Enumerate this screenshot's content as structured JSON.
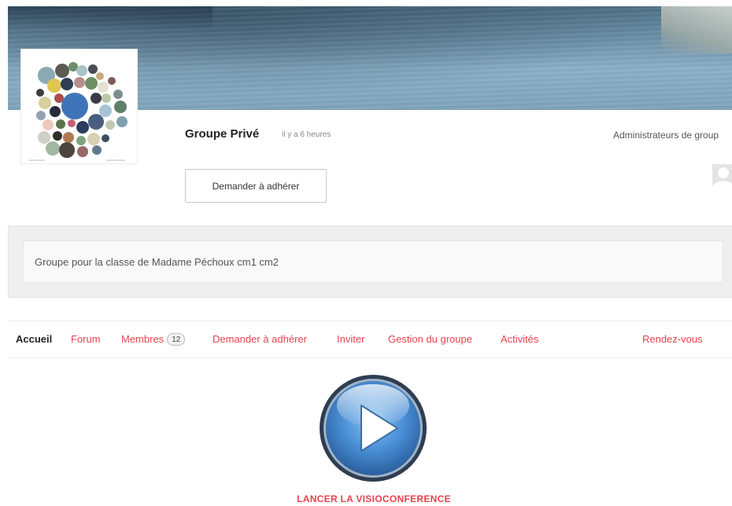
{
  "group": {
    "name": "Groupe Privé",
    "last_active": "il y a 6 heures",
    "join_button": "Demander à adhérer",
    "admins_label": "Administrateurs de group",
    "description": "Groupe pour la classe de Madame Péchoux cm1 cm2"
  },
  "nav": {
    "tabs": [
      {
        "label": "Accueil",
        "active": true
      },
      {
        "label": "Forum"
      },
      {
        "label": "Membres",
        "badge": "12"
      },
      {
        "label": "Demander à adhérer"
      },
      {
        "label": "Inviter"
      },
      {
        "label": "Gestion du groupe"
      },
      {
        "label": "Activités"
      },
      {
        "label": "Rendez-vous"
      }
    ]
  },
  "visio": {
    "label": "LANCER LA VISIOCONFERENCE",
    "icon": "play-icon"
  },
  "colors": {
    "accent": "#e5434f",
    "active_tab": "#222222",
    "play_blue": "#4a8fd6"
  }
}
